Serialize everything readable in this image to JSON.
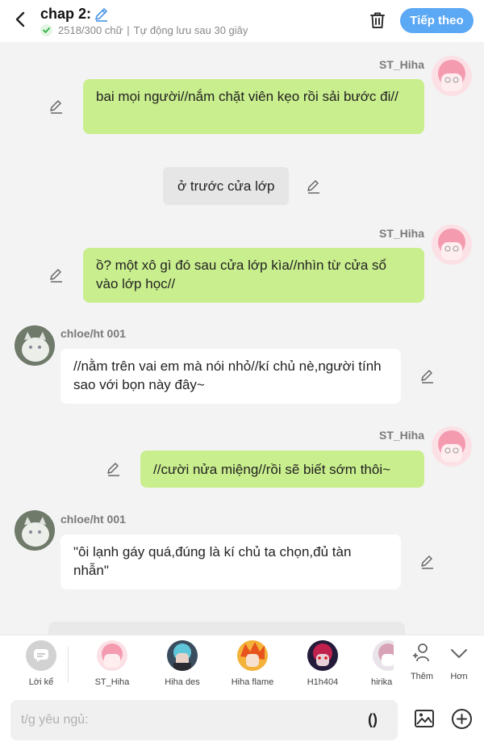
{
  "header": {
    "title": "chap 2:",
    "word_count": "2518/300 chữ",
    "separator": "|",
    "autosave": "Tự động lưu sau 30 giây",
    "next_label": "Tiếp theo"
  },
  "messages": [
    {
      "type": "own",
      "name": "ST_Hiha",
      "text": "bai mọi người//nắm chặt viên kẹo rồi sải bước đi//"
    },
    {
      "type": "narration",
      "text": "ở trước cửa lớp"
    },
    {
      "type": "own",
      "name": "ST_Hiha",
      "text": "ồ? một xô gì đó sau cửa lớp kìa//nhìn từ cửa sổ vào lớp học//"
    },
    {
      "type": "other",
      "name": "chloe/ht 001",
      "text": "//nằm trên vai em mà nói nhỏ//kí chủ nè,người tính sao với bọn này đây~"
    },
    {
      "type": "own",
      "name": "ST_Hiha",
      "text": "//cười nửa miệng//rồi sẽ biết sớm thôi~"
    },
    {
      "type": "other",
      "name": "chloe/ht 001",
      "text": "\"ôi lạnh gáy quá,đúng là kí chủ ta chọn,đủ tàn nhẫn\""
    }
  ],
  "charbar": {
    "narrator_label": "Lời kể",
    "characters": [
      {
        "label": "ST_Hiha"
      },
      {
        "label": "Hiha des"
      },
      {
        "label": "Hiha flame"
      },
      {
        "label": "H1h404"
      },
      {
        "label": "hirika"
      }
    ],
    "add_label": "Thêm",
    "more_label": "Hơn"
  },
  "input": {
    "placeholder": "t/g yêu ngủ:",
    "paren_label": "()"
  },
  "colors": {
    "accent": "#5ba8f5",
    "own_bubble": "#c9ee8d",
    "other_bubble": "#ffffff",
    "narration_bubble": "#e6e6e6",
    "background": "#f3f3f3"
  }
}
